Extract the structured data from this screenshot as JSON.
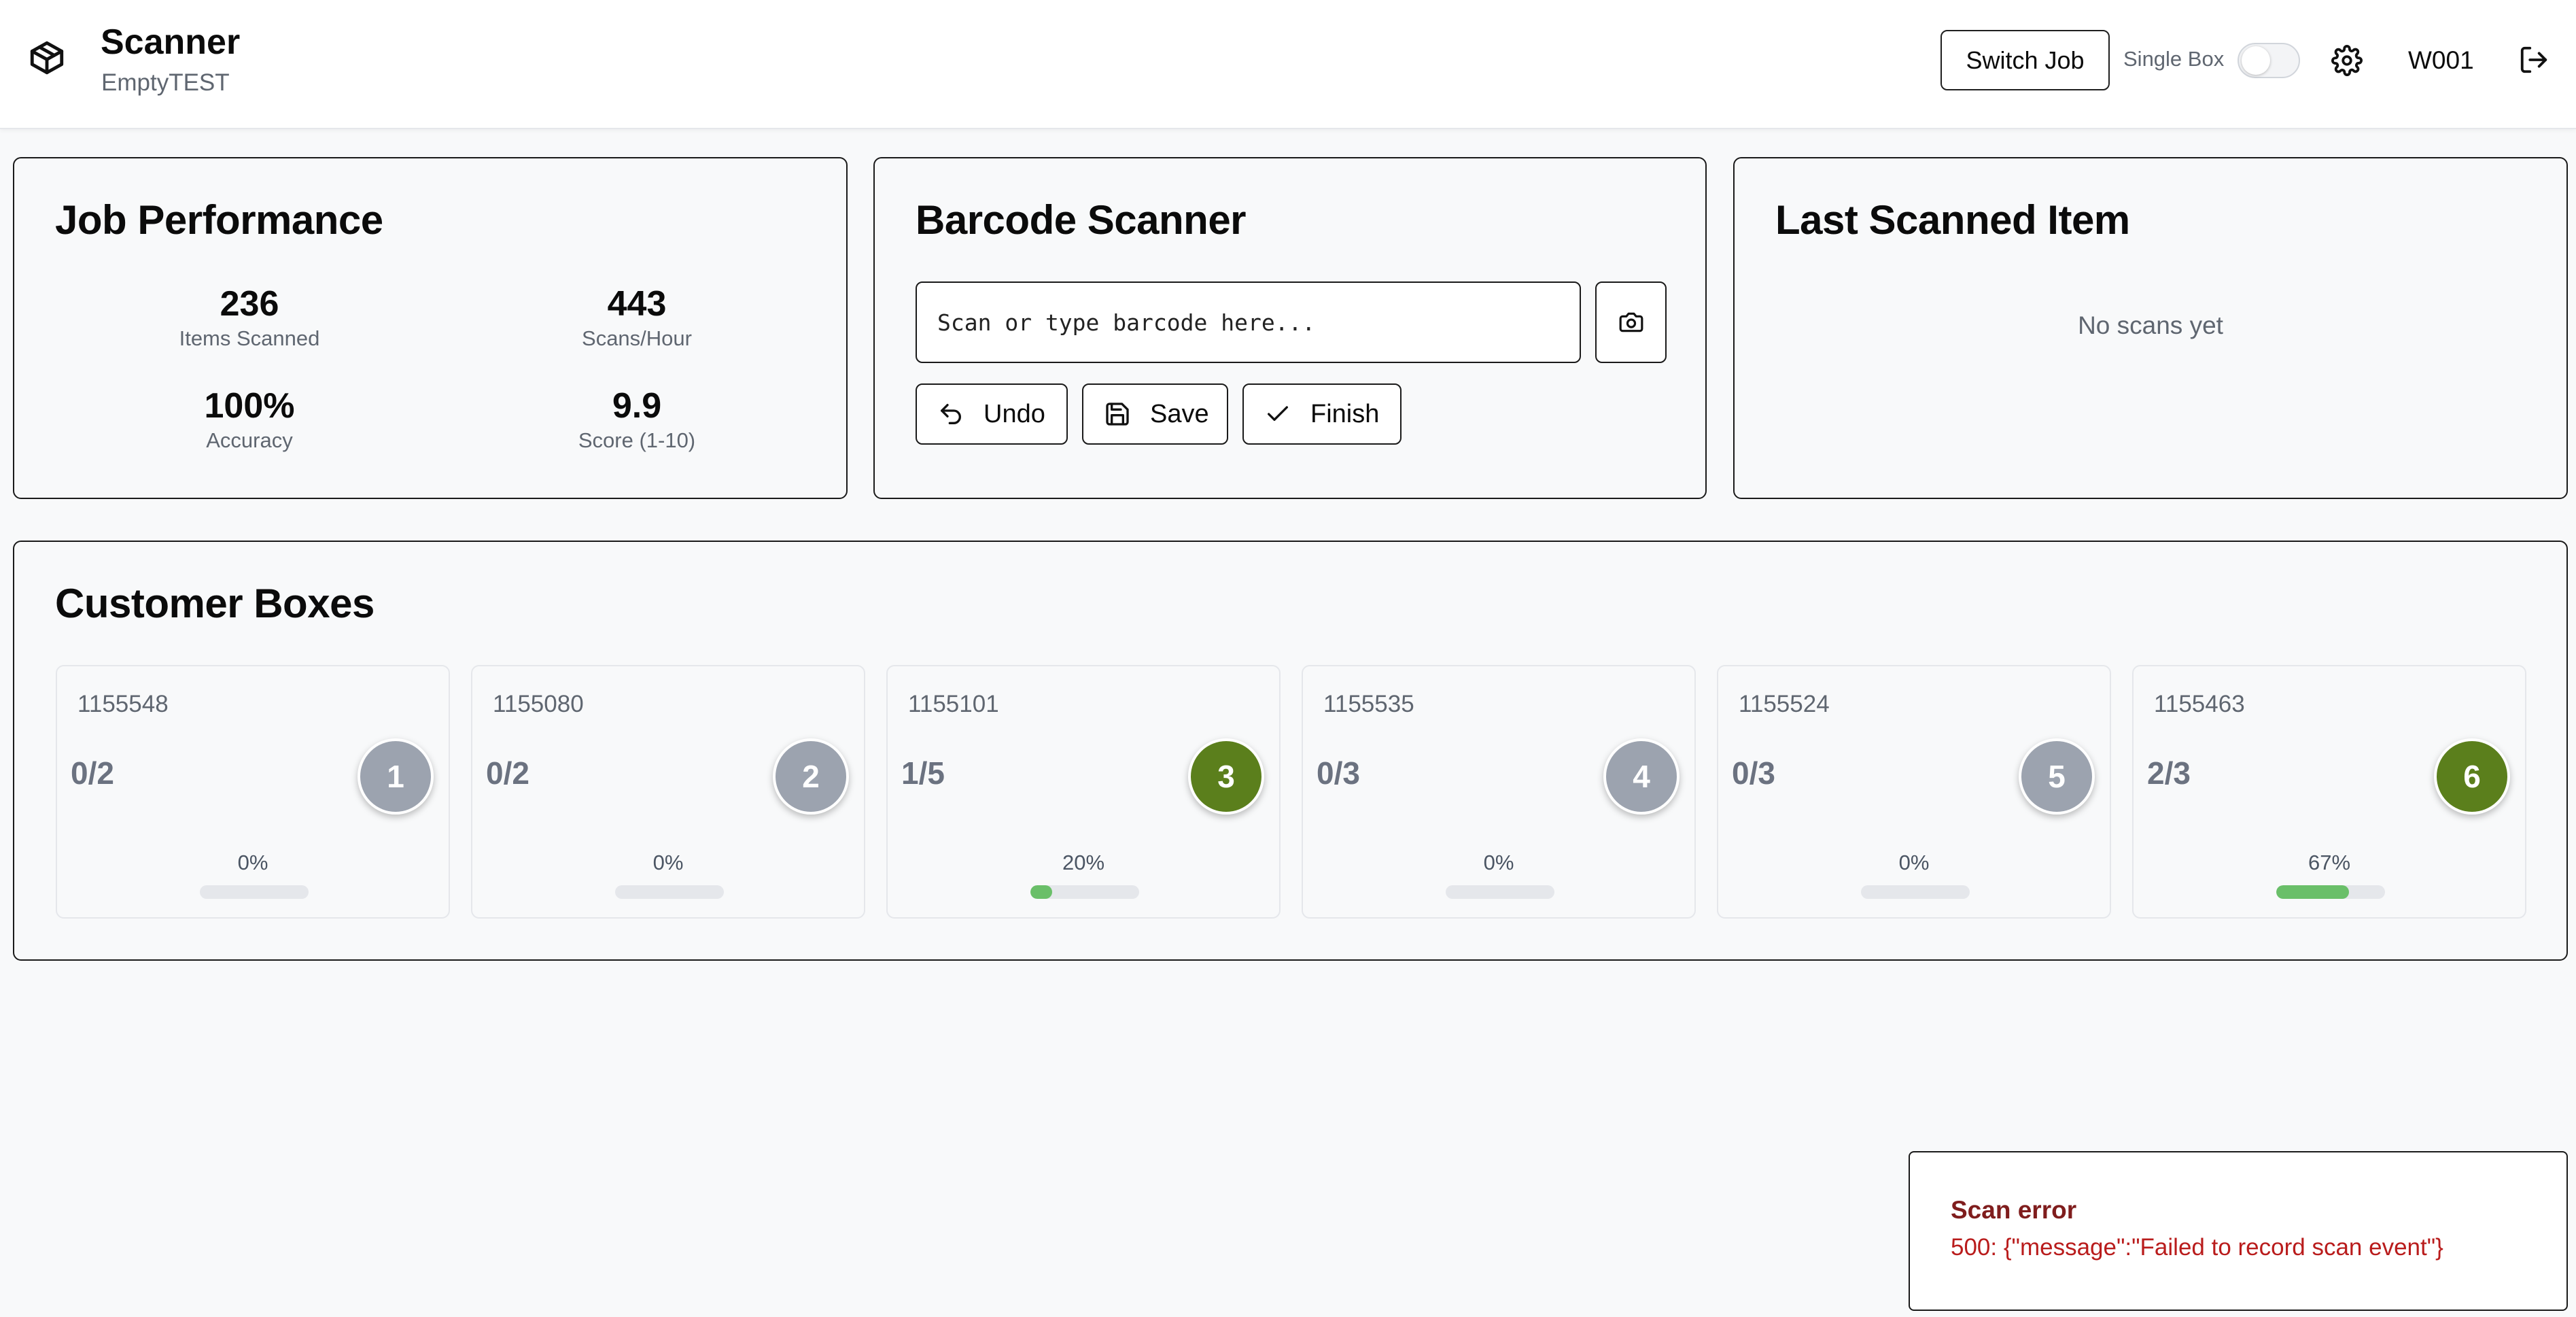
{
  "header": {
    "app_title": "Scanner",
    "app_subtitle": "EmptyTEST",
    "switch_job_label": "Switch Job",
    "single_box_label": "Single Box",
    "single_box_enabled": false,
    "user_id": "W001"
  },
  "performance": {
    "title": "Job Performance",
    "metrics": [
      {
        "value": "236",
        "label": "Items Scanned"
      },
      {
        "value": "443",
        "label": "Scans/Hour"
      },
      {
        "value": "100%",
        "label": "Accuracy"
      },
      {
        "value": "9.9",
        "label": "Score (1-10)"
      }
    ]
  },
  "scanner": {
    "title": "Barcode Scanner",
    "input_placeholder": "Scan or type barcode here...",
    "input_value": "",
    "undo_label": "Undo",
    "save_label": "Save",
    "finish_label": "Finish"
  },
  "last_scanned": {
    "title": "Last Scanned Item",
    "empty_text": "No scans yet"
  },
  "customer_boxes": {
    "title": "Customer Boxes",
    "boxes": [
      {
        "id": "1155548",
        "count": "0/2",
        "badge": "1",
        "percent_label": "0%",
        "progress": 0,
        "badge_color": "#9ca3af"
      },
      {
        "id": "1155080",
        "count": "0/2",
        "badge": "2",
        "percent_label": "0%",
        "progress": 0,
        "badge_color": "#9ca3af"
      },
      {
        "id": "1155101",
        "count": "1/5",
        "badge": "3",
        "percent_label": "20%",
        "progress": 0.2,
        "badge_color": "#5b7f1c"
      },
      {
        "id": "1155535",
        "count": "0/3",
        "badge": "4",
        "percent_label": "0%",
        "progress": 0,
        "badge_color": "#9ca3af"
      },
      {
        "id": "1155524",
        "count": "0/3",
        "badge": "5",
        "percent_label": "0%",
        "progress": 0,
        "badge_color": "#9ca3af"
      },
      {
        "id": "1155463",
        "count": "2/3",
        "badge": "6",
        "percent_label": "67%",
        "progress": 0.67,
        "badge_color": "#5b7f1c"
      }
    ]
  },
  "toast": {
    "title": "Scan error",
    "message": "500: {\"message\":\"Failed to record scan event\"}"
  },
  "colors": {
    "accent_green": "#5b7f1c",
    "inactive_grey": "#9ca3af",
    "progress_green": "#6abf69",
    "error_red": "#b91c1c"
  }
}
